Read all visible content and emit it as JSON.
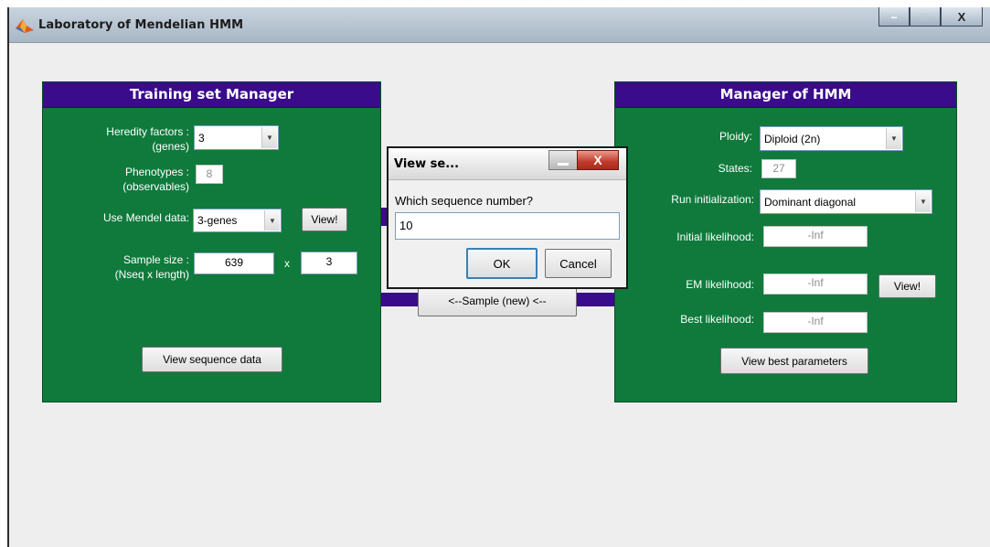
{
  "window": {
    "title": "Laboratory of Mendelian HMM",
    "controls": {
      "minimize": "–",
      "maximize": "□",
      "close": "X"
    }
  },
  "training": {
    "header": "Training set Manager",
    "heredity_label": "Heredity factors :\n(genes)",
    "heredity_value": "3",
    "phenotypes_label": "Phenotypes :\n(observables)",
    "phenotypes_value": "8",
    "mendel_label": "Use Mendel data:",
    "mendel_value": "3-genes",
    "view_button": "View!",
    "sample_label": "Sample size :\n(Nseq x length)",
    "nseq_value": "639",
    "times": "x",
    "length_value": "3",
    "view_sequence_button": "View sequence data"
  },
  "middle": {
    "sample_button": "<--Sample (new) <--"
  },
  "hmm": {
    "header": "Manager of HMM",
    "ploidy_label": "Ploidy:",
    "ploidy_value": "Diploid (2n)",
    "states_label": "States:",
    "states_value": "27",
    "run_init_label": "Run initialization:",
    "run_init_value": "Dominant diagonal",
    "initial_likelihood_label": "Initial likelihood:",
    "initial_likelihood_value": "-Inf",
    "em_likelihood_label": "EM likelihood:",
    "em_likelihood_value": "-Inf",
    "em_view_button": "View!",
    "best_likelihood_label": "Best likelihood:",
    "best_likelihood_value": "-Inf",
    "best_params_button": "View best parameters"
  },
  "dialog": {
    "title": "View se...",
    "prompt": "Which sequence number?",
    "input_value": "10",
    "ok": "OK",
    "cancel": "Cancel",
    "close": "X"
  },
  "colors": {
    "panel_green": "#0f7a3c",
    "header_purple": "#3a0b8a"
  }
}
